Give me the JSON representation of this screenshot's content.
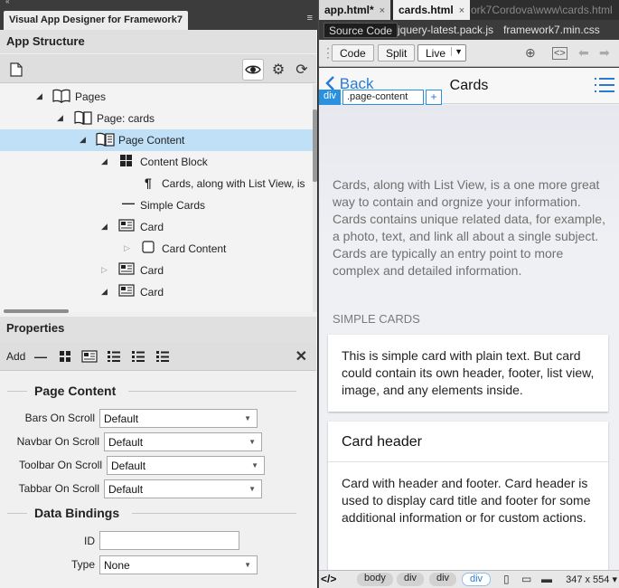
{
  "left_panel": {
    "panel_tab": "Visual App Designer for Framework7",
    "app_structure_title": "App Structure",
    "tree": [
      {
        "label": "Pages",
        "icon": "book-icon"
      },
      {
        "label": "Page: cards",
        "icon": "page-icon"
      },
      {
        "label": "Page Content",
        "icon": "page-content-icon"
      },
      {
        "label": "Content Block",
        "icon": "block-icon"
      },
      {
        "label": "Cards, along with List View, is",
        "icon": "paragraph-icon"
      },
      {
        "label": "Simple Cards",
        "icon": "dash-icon"
      },
      {
        "label": "Card",
        "icon": "card-icon"
      },
      {
        "label": "Card Content",
        "icon": "card-content-icon"
      },
      {
        "label": "Card",
        "icon": "card-icon"
      },
      {
        "label": "Card",
        "icon": "card-icon"
      }
    ],
    "properties_title": "Properties",
    "add_label": "Add",
    "page_content_heading": "Page Content",
    "props": [
      {
        "label": "Bars On Scroll",
        "value": "Default"
      },
      {
        "label": "Navbar On Scroll",
        "value": "Default"
      },
      {
        "label": "Toolbar On Scroll",
        "value": "Default"
      },
      {
        "label": "Tabbar On Scroll",
        "value": "Default"
      }
    ],
    "data_bindings_heading": "Data Bindings",
    "id_label": "ID",
    "id_value": "",
    "type_label": "Type",
    "type_value": "None"
  },
  "right_panel": {
    "tabs": [
      {
        "label": "app.html*",
        "close": "×"
      },
      {
        "label": "cards.html",
        "close": "×"
      }
    ],
    "doc_path": "ork7Cordova\\www\\cards.html",
    "source_code_label": "Source Code",
    "related_files": [
      "jquery-latest.pack.js",
      "framework7.min.css"
    ],
    "view_buttons": {
      "code": "Code",
      "split": "Split",
      "live": "Live"
    },
    "preview": {
      "nav_back": "Back",
      "nav_title": "Cards",
      "sel_tag": "div",
      "sel_class": ".page-content",
      "sel_plus": "+",
      "intro": "Cards, along with List View, is a one more great way to contain and orgnize your information. Cards contains unique related data, for example, a photo, text, and link all about a single subject. Cards are typically an entry point to more complex and detailed information.",
      "block_title": "SIMPLE CARDS",
      "card1_text": "This is simple card with plain text. But card could contain its own header, footer, list view, image, and any elements inside.",
      "card2_header": "Card header",
      "card2_text": "Card with header and footer. Card header is used to display card title and footer for some additional information or for custom actions."
    },
    "status": {
      "tag_code": "</>",
      "crumbs": [
        "body",
        "div",
        "div",
        "div"
      ],
      "size": "347 x 554"
    }
  }
}
